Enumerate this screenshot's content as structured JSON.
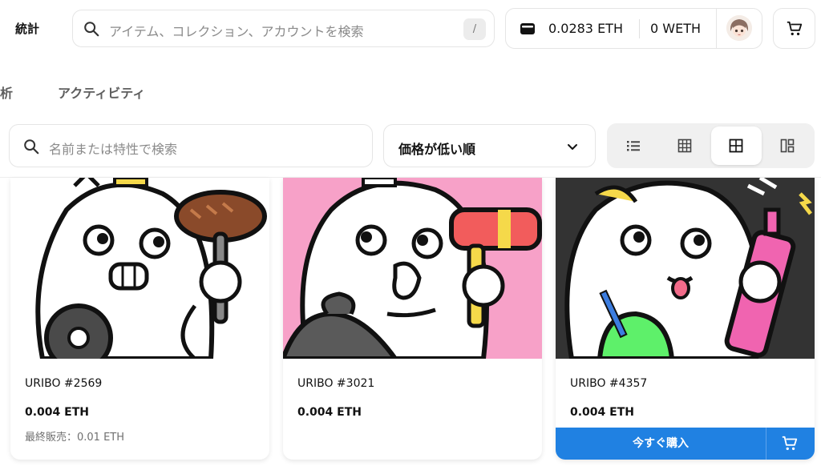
{
  "header": {
    "stats_label": "統計",
    "search_placeholder": "アイテム、コレクション、アカウントを検索",
    "search_shortcut": "/",
    "wallet": {
      "eth_balance": "0.0283 ETH",
      "weth_balance": "0 WETH"
    }
  },
  "tabs": {
    "partial_label": "析",
    "activity_label": "アクティビティ"
  },
  "filter": {
    "search_placeholder": "名前または特性で検索",
    "sort_value": "価格が低い順",
    "view_modes": [
      "list-view-icon",
      "grid-large-icon",
      "grid-medium-icon",
      "grid-mosaic-icon"
    ],
    "active_view": "grid-medium-icon"
  },
  "items": [
    {
      "name": "URIBO #2569",
      "price": "0.004 ETH",
      "last_sale": "最終販売：0.01 ETH",
      "bg": "#ffffff"
    },
    {
      "name": "URIBO #3021",
      "price": "0.004 ETH",
      "last_sale": "",
      "bg": "#f7a1c8"
    },
    {
      "name": "URIBO #4357",
      "price": "0.004 ETH",
      "last_sale": "",
      "bg": "#333333",
      "buy_label": "今すぐ購入"
    }
  ],
  "colors": {
    "accent": "#2081e2"
  }
}
